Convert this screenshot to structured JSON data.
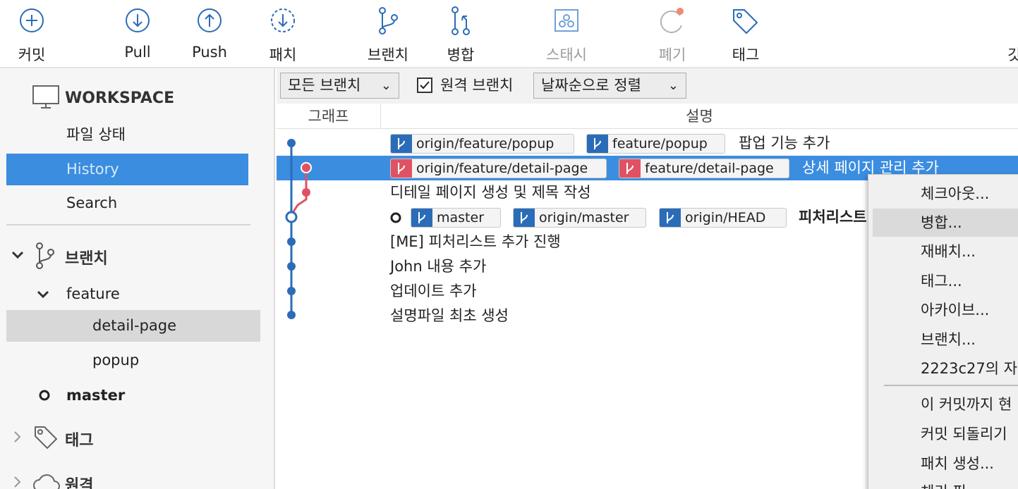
{
  "toolbar": {
    "commit": "커밋",
    "pull": "Pull",
    "push": "Push",
    "patch": "패치",
    "branch": "브랜치",
    "merge": "병합",
    "stash": "스태시",
    "discard": "폐기",
    "tag": "태그",
    "overflow": "깃"
  },
  "sidebar": {
    "workspace": "WORKSPACE",
    "file_status": "파일 상태",
    "history": "History",
    "search": "Search",
    "branches": "브랜치",
    "feature": "feature",
    "detail_page": "detail-page",
    "popup": "popup",
    "master": "master",
    "tags": "태그",
    "remotes": "원격"
  },
  "filter": {
    "branches_dropdown": "모든 브랜치",
    "remote_checkbox_label": "원격 브랜치",
    "remote_checked": true,
    "sort_dropdown": "날짜순으로 정렬"
  },
  "columns": {
    "graph": "그래프",
    "description": "설명"
  },
  "commits": [
    {
      "tags": [
        {
          "label": "origin/feature/popup",
          "color": "#2b6cb8"
        },
        {
          "label": "feature/popup",
          "color": "#2b6cb8"
        }
      ],
      "message": "팝업 기능 추가"
    },
    {
      "tags": [
        {
          "label": "origin/feature/detail-page",
          "color": "#e05263"
        },
        {
          "label": "feature/detail-page",
          "color": "#e05263"
        }
      ],
      "message": "상세 페이지 관리 추가"
    },
    {
      "tags": [],
      "message": "디테일 페이지 생성 및 제목 작성"
    },
    {
      "tags": [
        {
          "label": "master",
          "color": "#2b6cb8"
        },
        {
          "label": "origin/master",
          "color": "#2b6cb8"
        },
        {
          "label": "origin/HEAD",
          "color": "#2b6cb8"
        }
      ],
      "message": "피처리스트"
    },
    {
      "tags": [],
      "message": "[ME] 피처리스트 추가 진행"
    },
    {
      "tags": [],
      "message": "John 내용 추가"
    },
    {
      "tags": [],
      "message": "업데이트 추가"
    },
    {
      "tags": [],
      "message": "설명파일 최초 생성"
    }
  ],
  "context_menu": {
    "items": [
      "체크아웃...",
      "병합...",
      "재배치...",
      "태그...",
      "아카이브...",
      "브랜치...",
      "2223c27의 자"
    ],
    "items2": [
      "이 커밋까지 현",
      "커밋 되돌리기",
      "패치 생성...",
      "체리 픽"
    ]
  },
  "colors": {
    "accent_blue": "#3b8de0",
    "graph_blue": "#2b6cb8",
    "graph_red": "#e05263"
  }
}
